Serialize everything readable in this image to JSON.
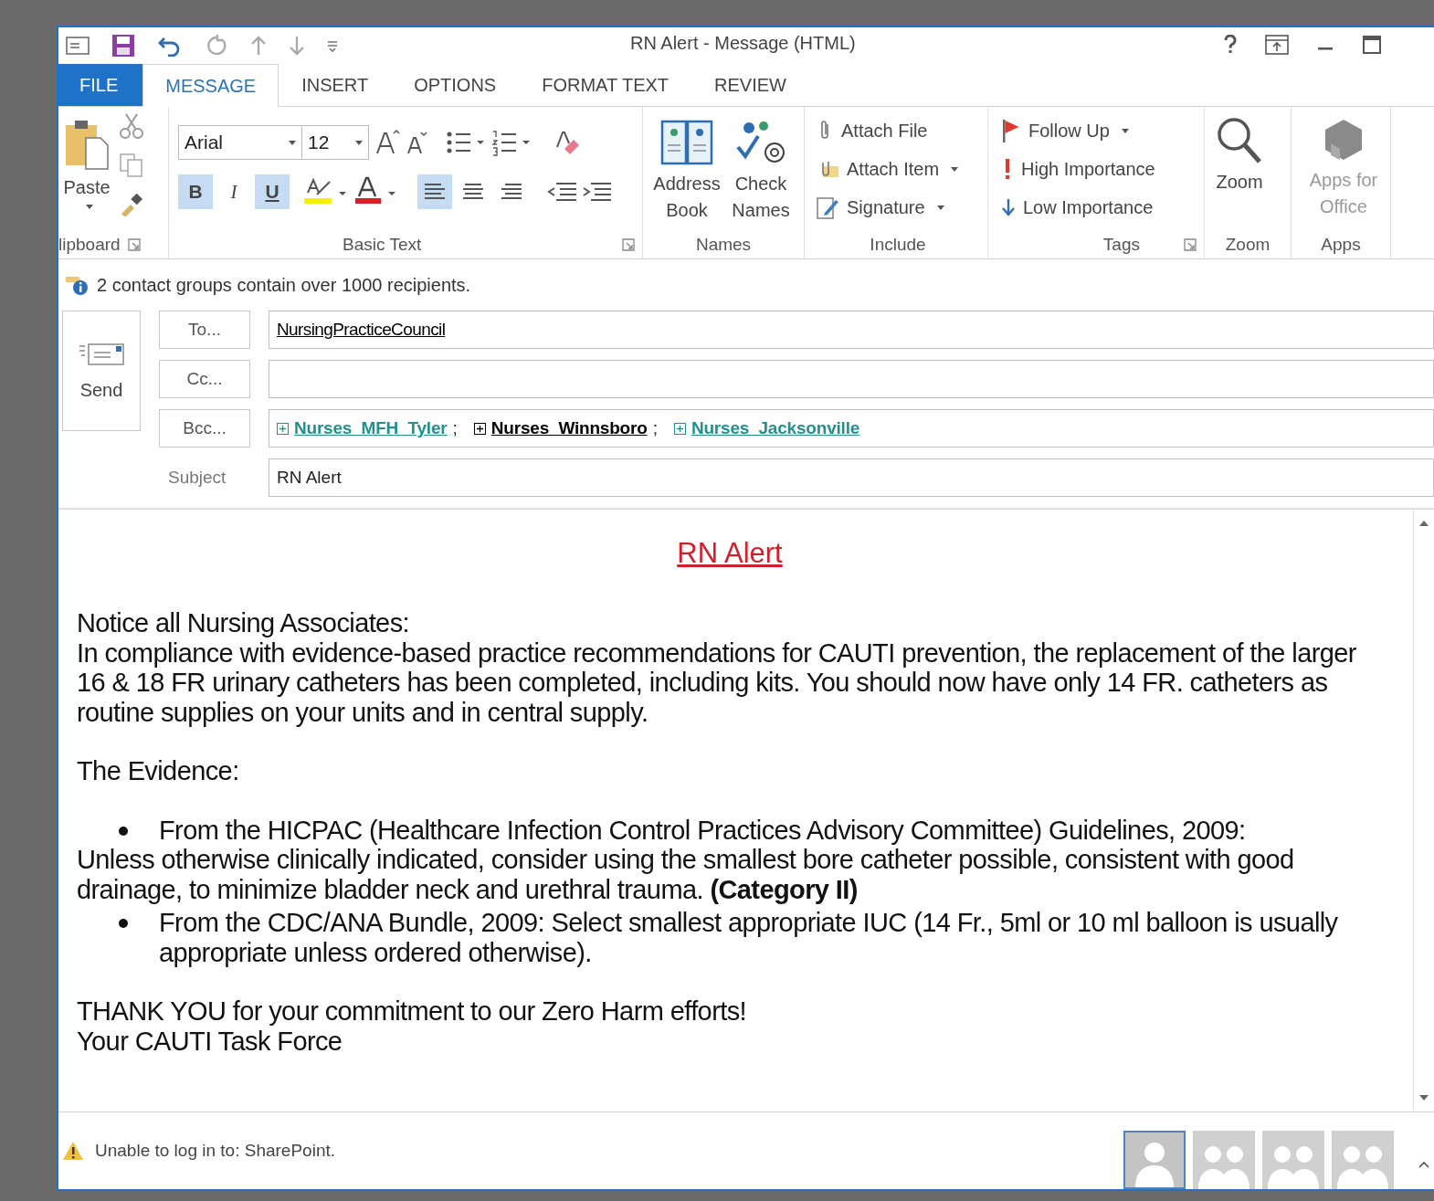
{
  "window": {
    "title": "RN Alert - Message (HTML)"
  },
  "tabs": [
    {
      "label": "FILE",
      "kind": "file",
      "selected": false
    },
    {
      "label": "MESSAGE",
      "kind": "tab",
      "selected": true
    },
    {
      "label": "INSERT",
      "kind": "tab",
      "selected": false
    },
    {
      "label": "OPTIONS",
      "kind": "tab",
      "selected": false
    },
    {
      "label": "FORMAT TEXT",
      "kind": "tab",
      "selected": false
    },
    {
      "label": "REVIEW",
      "kind": "tab",
      "selected": false
    }
  ],
  "clipboard": {
    "label": "lipboard",
    "paste": "Paste"
  },
  "basic_text": {
    "label": "Basic Text",
    "font": "Arial",
    "size": "12",
    "styles": [
      {
        "kind": "bold",
        "label": "B",
        "selected": true
      },
      {
        "kind": "italic",
        "label": "I",
        "selected": false
      },
      {
        "kind": "underline",
        "label": "U",
        "selected": true
      }
    ],
    "align": [
      {
        "kind": "left",
        "selected": true
      },
      {
        "kind": "center",
        "selected": false
      },
      {
        "kind": "right",
        "selected": false
      }
    ]
  },
  "names": {
    "label": "Names",
    "buttons": [
      {
        "kind": "address-book",
        "label": "Address Book"
      },
      {
        "kind": "check-names",
        "label": "Check Names"
      }
    ]
  },
  "include": {
    "label": "Include",
    "items": [
      {
        "kind": "attach-file",
        "label": "Attach File",
        "dropdown": false
      },
      {
        "kind": "attach-item",
        "label": "Attach Item",
        "dropdown": true
      },
      {
        "kind": "signature",
        "label": "Signature",
        "dropdown": true
      }
    ]
  },
  "tags": {
    "label": "Tags",
    "items": [
      {
        "kind": "follow-up",
        "label": "Follow Up",
        "dropdown": true
      },
      {
        "kind": "high",
        "label": "High Importance",
        "dropdown": false
      },
      {
        "kind": "low",
        "label": "Low Importance",
        "dropdown": false
      }
    ]
  },
  "zoom": {
    "label": "Zoom",
    "button": "Zoom"
  },
  "apps": {
    "label": "Apps",
    "button": "Apps for Office",
    "disabled": true
  },
  "info_bar": {
    "text": "2 contact groups contain over 1000 recipients."
  },
  "send": {
    "label": "Send"
  },
  "fields": [
    {
      "button": "To...",
      "recipients": [
        {
          "name": "NursingPracticeCouncil",
          "group": false,
          "color": "#000000"
        }
      ]
    },
    {
      "button": "Cc..."
    },
    {
      "button": "Bcc...",
      "recipients": [
        {
          "name": "Nurses_MFH_Tyler",
          "group": true,
          "color": "#23908f",
          "separator": ";"
        },
        {
          "name": "Nurses_Winnsboro",
          "group": true,
          "color": "#000000",
          "separator": ";"
        },
        {
          "name": "Nurses_Jacksonville",
          "group": true,
          "color": "#23908f"
        }
      ]
    }
  ],
  "subject": {
    "label": "Subject",
    "value": "RN Alert"
  },
  "body": {
    "heading": "RN Alert",
    "blocks": [
      {
        "kind": "para",
        "lines": [
          "Notice all Nursing Associates:",
          "In compliance with evidence-based practice recommendations for CAUTI prevention, the replacement of the larger 16 & 18 FR urinary catheters has been completed, including kits. You should now have only 14 FR. catheters as routine supplies on your units and in central supply."
        ]
      },
      {
        "kind": "para",
        "lines": [
          "The Evidence:"
        ]
      },
      {
        "kind": "bullet",
        "text": "From the HICPAC (Healthcare Infection Control Practices Advisory Committee) Guidelines, 2009:"
      },
      {
        "kind": "plain",
        "text": "Unless otherwise clinically indicated, consider using the smallest bore catheter possible, consistent with good drainage, to minimize bladder neck and urethral trauma. **(Category II)**"
      },
      {
        "kind": "bullet",
        "text": "From the CDC/ANA Bundle, 2009: Select smallest appropriate IUC (14 Fr., 5ml or 10 ml balloon is usually appropriate unless ordered otherwise)."
      },
      {
        "kind": "para",
        "lines": [
          "THANK YOU for your commitment to our Zero Harm efforts!",
          "Your CAUTI Task Force"
        ]
      }
    ]
  },
  "status_bar": {
    "text": "Unable to log in to: SharePoint.",
    "people": [
      {
        "kind": "person",
        "selected": true
      },
      {
        "kind": "group",
        "selected": false
      },
      {
        "kind": "group",
        "selected": false
      },
      {
        "kind": "group",
        "selected": false
      }
    ]
  }
}
